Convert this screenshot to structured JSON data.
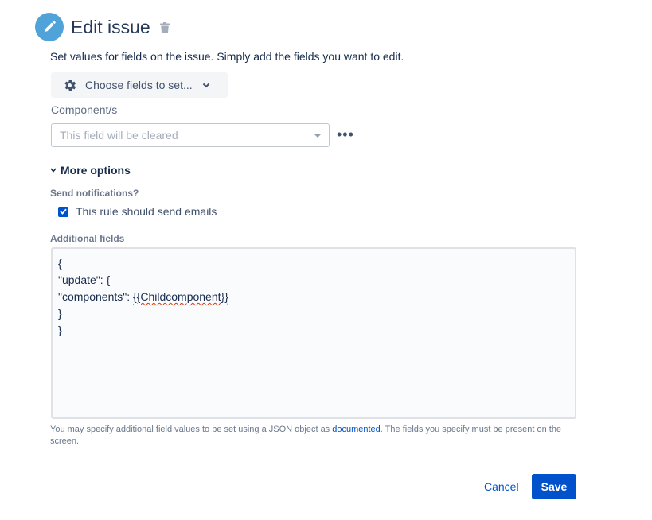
{
  "header": {
    "title": "Edit issue",
    "edit_icon": "pencil-icon",
    "delete_icon": "trash-icon"
  },
  "description": "Set values for fields on the issue. Simply add the fields you want to edit.",
  "choose_fields": {
    "label": "Choose fields to set...",
    "icon": "gear-icon"
  },
  "component_field": {
    "label": "Component/s",
    "placeholder": "This field will be cleared",
    "more_label": "•••"
  },
  "more_options": {
    "label": "More options"
  },
  "notifications": {
    "label": "Send notifications?",
    "checkbox_label": "This rule should send emails",
    "checked": true
  },
  "additional_fields": {
    "label": "Additional fields",
    "lines": [
      "{",
      "\"update\": {",
      "\"components\": ",
      "}",
      "}"
    ],
    "smart_value": "{{Childcomponent}}",
    "help_before": "You may specify additional field values to be set using a JSON object as ",
    "help_link": "documented",
    "help_after": ". The fields you specify must be present on the screen."
  },
  "buttons": {
    "cancel": "Cancel",
    "save": "Save"
  },
  "colors": {
    "accent": "#0052cc",
    "edit_icon_bg": "#4fa3d9"
  }
}
